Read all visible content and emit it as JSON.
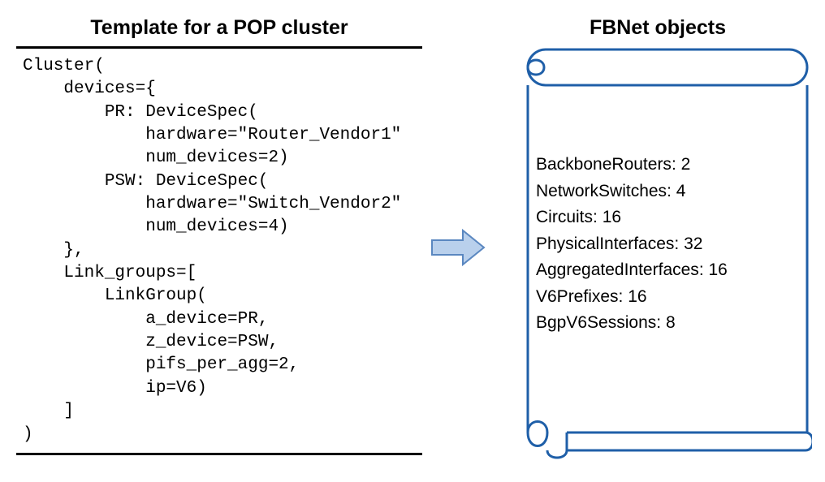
{
  "left": {
    "title": "Template for a POP cluster",
    "code": "Cluster(\n    devices={\n        PR: DeviceSpec(\n            hardware=\"Router_Vendor1\"\n            num_devices=2)\n        PSW: DeviceSpec(\n            hardware=\"Switch_Vendor2\"\n            num_devices=4)\n    },\n    Link_groups=[\n        LinkGroup(\n            a_device=PR,\n            z_device=PSW,\n            pifs_per_agg=2,\n            ip=V6)\n    ]\n)"
  },
  "right": {
    "title": "FBNet objects",
    "items": [
      {
        "label": "BackboneRouters",
        "value": "2"
      },
      {
        "label": "NetworkSwitches",
        "value": "4"
      },
      {
        "label": "Circuits",
        "value": "16"
      },
      {
        "label": "PhysicalInterfaces",
        "value": "32"
      },
      {
        "label": "AggregatedInterfaces",
        "value": "16"
      },
      {
        "label": "V6Prefixes",
        "value": "16"
      },
      {
        "label": "BgpV6Sessions",
        "value": "8"
      }
    ]
  },
  "colors": {
    "scroll_stroke": "#1f5fa8",
    "arrow_fill": "#b9d0ec",
    "arrow_stroke": "#5a87c0"
  }
}
